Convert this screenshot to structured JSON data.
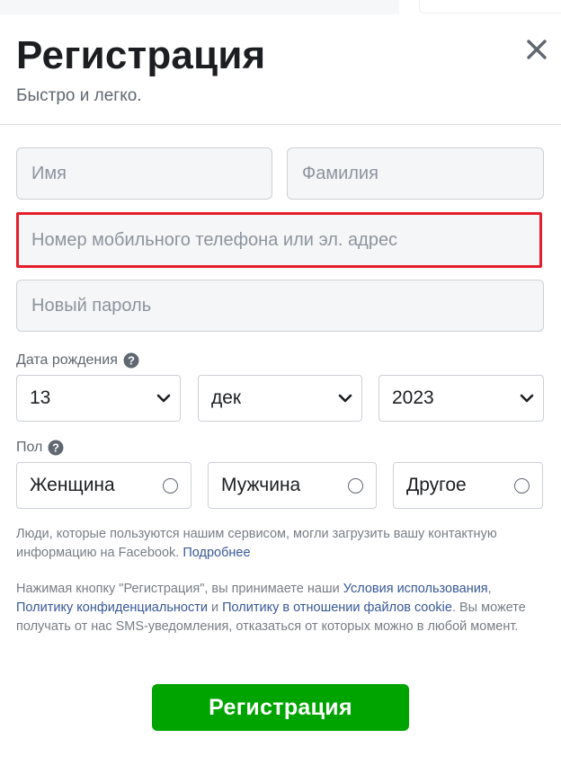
{
  "header": {
    "title": "Регистрация",
    "subtitle": "Быстро и легко."
  },
  "form": {
    "first_name_placeholder": "Имя",
    "last_name_placeholder": "Фамилия",
    "contact_placeholder": "Номер мобильного телефона или эл. адрес",
    "password_placeholder": "Новый пароль"
  },
  "birthday": {
    "label": "Дата рождения",
    "day": "13",
    "month": "дек",
    "year": "2023"
  },
  "gender": {
    "label": "Пол",
    "options": [
      "Женщина",
      "Мужчина",
      "Другое"
    ]
  },
  "notes": {
    "contact_upload_text": "Люди, которые пользуются нашим сервисом, могли загрузить вашу контактную информацию на Facebook. ",
    "learn_more": "Подробнее",
    "terms_prefix": "Нажимая кнопку \"Регистрация\", вы принимаете наши ",
    "terms_link": "Условия использования",
    "terms_sep": ", ",
    "privacy_link": "Политику конфиденциальности",
    "terms_and": " и ",
    "cookies_link": "Политику в отношении файлов cookie",
    "terms_suffix": ". Вы можете получать от нас SMS-уведомления, отказаться от которых можно в любой момент."
  },
  "submit_label": "Регистрация",
  "colors": {
    "submit": "#00a400",
    "highlight_border": "#e41e2b",
    "link": "#385898"
  },
  "icons": {
    "close": "close-icon",
    "help": "question-circle-icon",
    "dropdown": "chevron-down-icon"
  }
}
